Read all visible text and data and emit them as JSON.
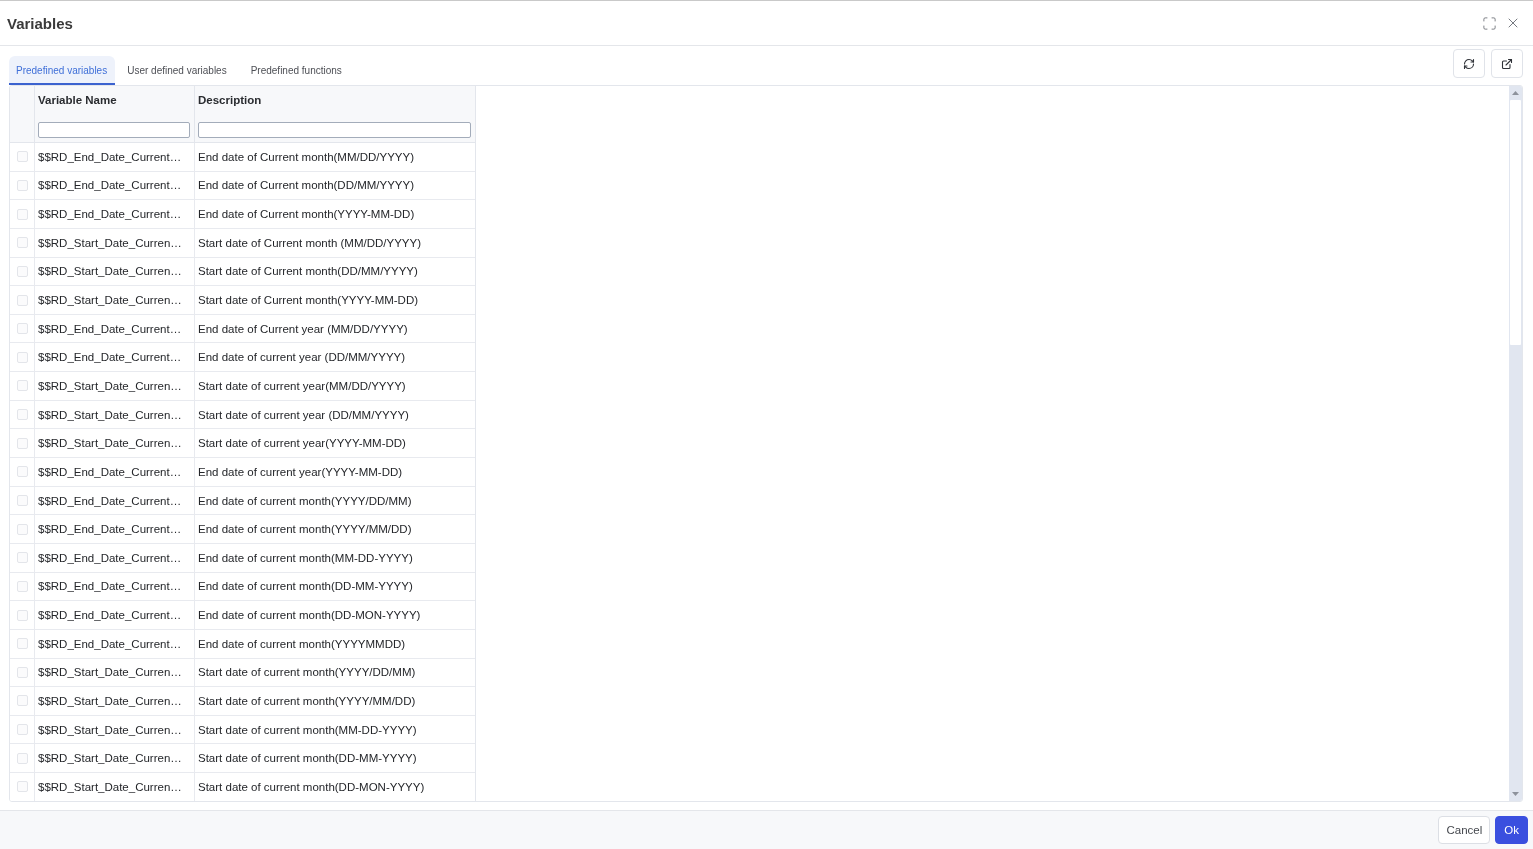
{
  "dialog": {
    "title": "Variables"
  },
  "tabs": [
    {
      "label": "Predefined variables",
      "selected": true
    },
    {
      "label": "User defined variables",
      "selected": false
    },
    {
      "label": "Predefined functions",
      "selected": false
    }
  ],
  "table": {
    "columns": [
      "Variable Name",
      "Description"
    ],
    "rows": [
      {
        "checked": false,
        "name": "$$RD_End_Date_Current…",
        "description": "End date of Current month(MM/DD/YYYY)"
      },
      {
        "checked": false,
        "name": "$$RD_End_Date_Current…",
        "description": "End date of Current month(DD/MM/YYYY)"
      },
      {
        "checked": false,
        "name": "$$RD_End_Date_Current…",
        "description": "End date of Current month(YYYY-MM-DD)"
      },
      {
        "checked": false,
        "name": "$$RD_Start_Date_Curren…",
        "description": "Start date of Current month (MM/DD/YYYY)"
      },
      {
        "checked": false,
        "name": "$$RD_Start_Date_Curren…",
        "description": "Start date of Current month(DD/MM/YYYY)"
      },
      {
        "checked": false,
        "name": "$$RD_Start_Date_Curren…",
        "description": "Start date of Current month(YYYY-MM-DD)"
      },
      {
        "checked": false,
        "name": "$$RD_End_Date_Current…",
        "description": "End date of Current year (MM/DD/YYYY)"
      },
      {
        "checked": false,
        "name": "$$RD_End_Date_Current…",
        "description": "End date of current year (DD/MM/YYYY)"
      },
      {
        "checked": false,
        "name": "$$RD_Start_Date_Curren…",
        "description": "Start date of current year(MM/DD/YYYY)"
      },
      {
        "checked": false,
        "name": "$$RD_Start_Date_Curren…",
        "description": "Start date of current year (DD/MM/YYYY)"
      },
      {
        "checked": false,
        "name": "$$RD_Start_Date_Curren…",
        "description": "Start date of current year(YYYY-MM-DD)"
      },
      {
        "checked": false,
        "name": "$$RD_End_Date_Current…",
        "description": "End date of current year(YYYY-MM-DD)"
      },
      {
        "checked": false,
        "name": "$$RD_End_Date_Current…",
        "description": "End date of current month(YYYY/DD/MM)"
      },
      {
        "checked": false,
        "name": "$$RD_End_Date_Current…",
        "description": "End date of current month(YYYY/MM/DD)"
      },
      {
        "checked": false,
        "name": "$$RD_End_Date_Current…",
        "description": "End date of current month(MM-DD-YYYY)"
      },
      {
        "checked": false,
        "name": "$$RD_End_Date_Current…",
        "description": "End date of current month(DD-MM-YYYY)"
      },
      {
        "checked": false,
        "name": "$$RD_End_Date_Current…",
        "description": "End date of current month(DD-MON-YYYY)"
      },
      {
        "checked": false,
        "name": "$$RD_End_Date_Current…",
        "description": "End date of current month(YYYYMMDD)"
      },
      {
        "checked": false,
        "name": "$$RD_Start_Date_Curren…",
        "description": "Start date of current month(YYYY/DD/MM)"
      },
      {
        "checked": false,
        "name": "$$RD_Start_Date_Curren…",
        "description": "Start date of current month(YYYY/MM/DD)"
      },
      {
        "checked": false,
        "name": "$$RD_Start_Date_Curren…",
        "description": "Start date of current month(MM-DD-YYYY)"
      },
      {
        "checked": false,
        "name": "$$RD_Start_Date_Curren…",
        "description": "Start date of current month(DD-MM-YYYY)"
      },
      {
        "checked": false,
        "name": "$$RD_Start_Date_Curren…",
        "description": "Start date of current month(DD-MON-YYYY)"
      }
    ]
  },
  "footer": {
    "buttons": [
      {
        "label": "Cancel",
        "kind": "secondary"
      },
      {
        "label": "Ok",
        "kind": "primary"
      }
    ]
  }
}
